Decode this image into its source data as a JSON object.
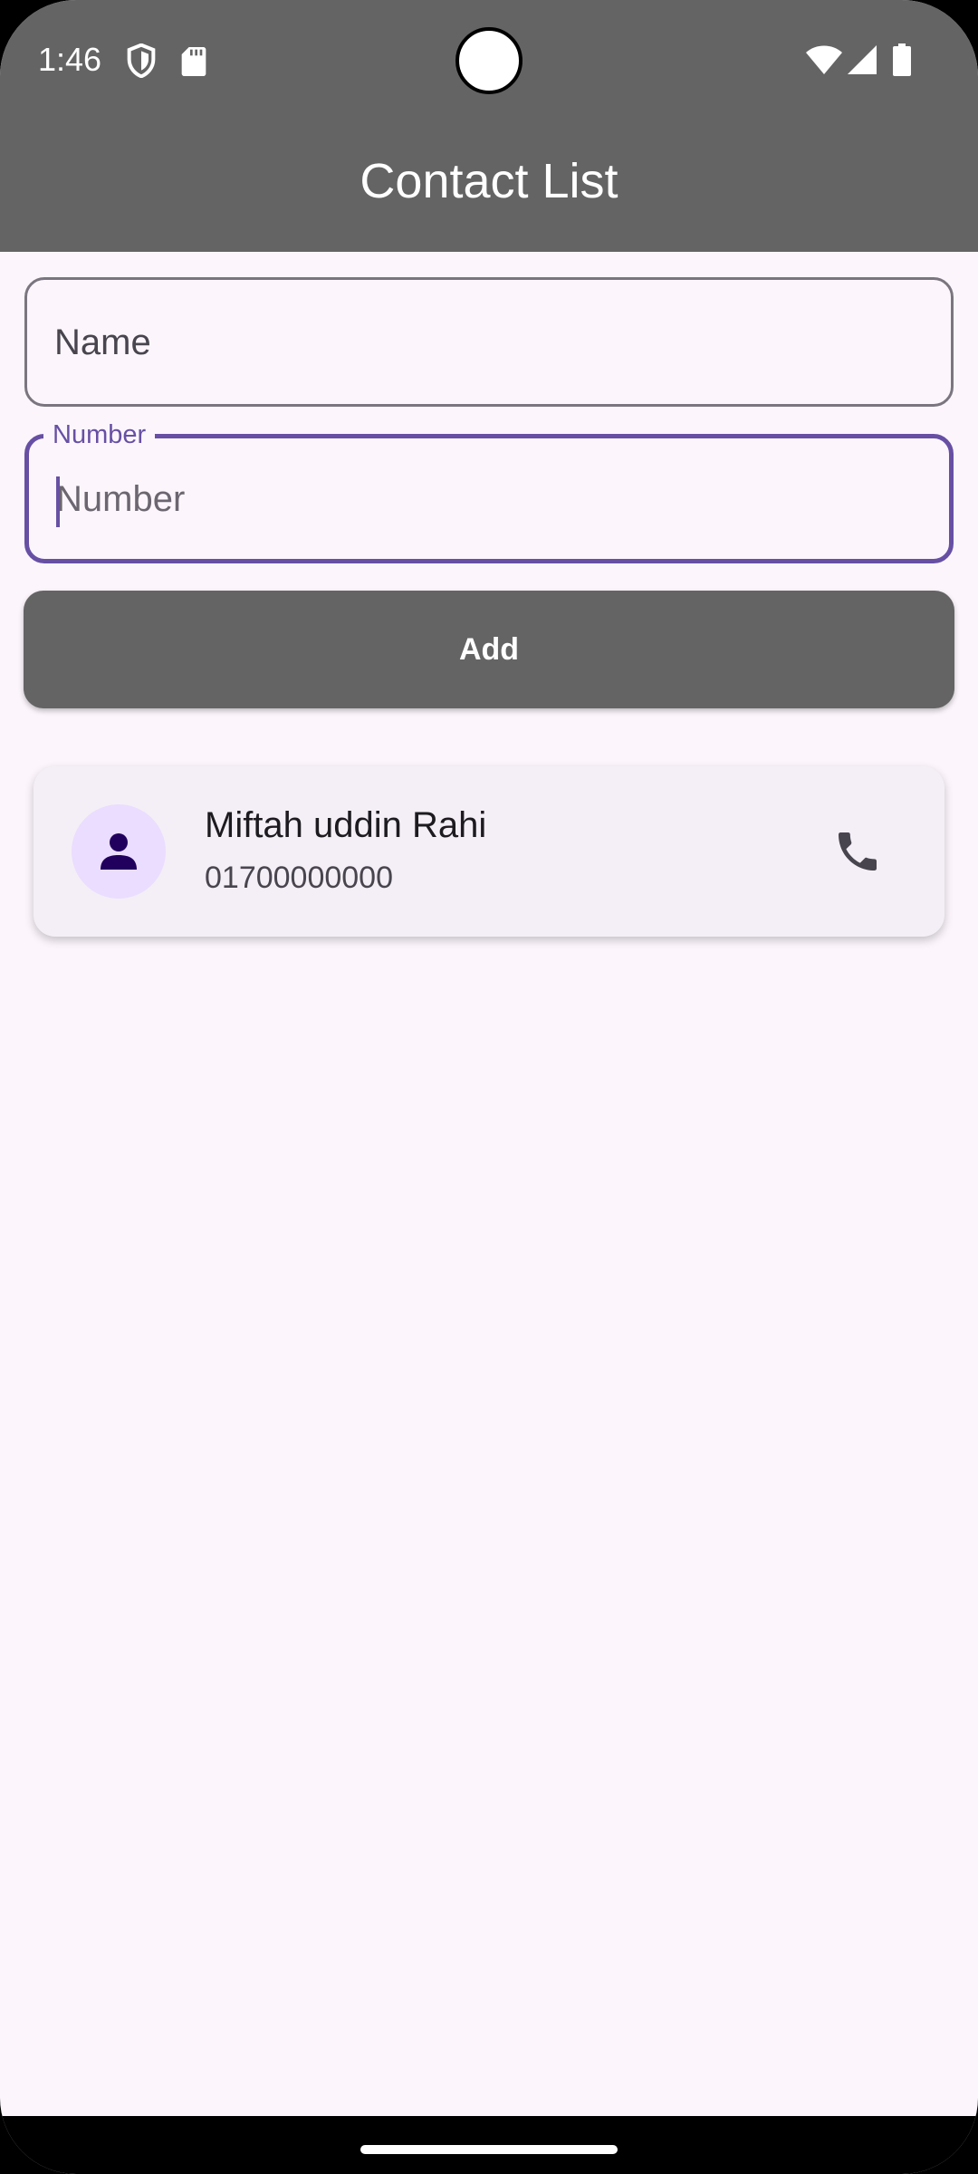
{
  "status_bar": {
    "time": "1:46",
    "icons": [
      "shield-icon",
      "sd-card-icon",
      "wifi-icon",
      "signal-icon",
      "battery-icon"
    ]
  },
  "app_bar": {
    "title": "Contact List"
  },
  "form": {
    "name_placeholder": "Name",
    "number_label": "Number",
    "number_placeholder": "Number",
    "add_label": "Add"
  },
  "contacts": [
    {
      "name": "Miftah uddin Rahi",
      "number": "01700000000",
      "avatar_icon": "person-icon",
      "action_icon": "phone-icon"
    }
  ],
  "colors": {
    "bar": "#646464",
    "background": "#fcf6fc",
    "accent": "#6750a4",
    "card": "#f4eff6",
    "avatar_bg": "#eaddff"
  }
}
